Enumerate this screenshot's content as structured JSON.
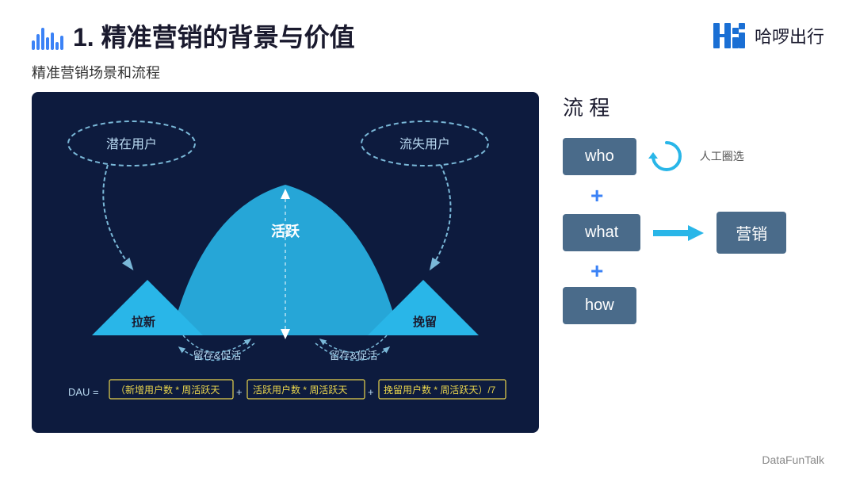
{
  "header": {
    "title": "1. 精准营销的背景与价值",
    "logo_text": "哈啰出行"
  },
  "subtitle": "精准营销场景和流程",
  "diagram": {
    "latent_users": "潜在用户",
    "lost_users": "流失用户",
    "active_label": "活跃",
    "acquire_label": "拉新",
    "retain_left": "留存&促活",
    "retain_right": "留存&促活",
    "churn_label": "挽留",
    "formula_prefix": "DAU =",
    "formula_part1": "（新增用户数 * 周活跃天",
    "formula_plus1": "+",
    "formula_part2": "活跃用户数 * 周活跃天",
    "formula_plus2": "+",
    "formula_part3": "挽留用户数 * 周活跃天）/7"
  },
  "flow": {
    "title": "流 程",
    "who_label": "who",
    "what_label": "what",
    "how_label": "how",
    "marketing_label": "营销",
    "manual_label": "人工圈选",
    "plus": "+",
    "arrow": "→"
  },
  "footer": {
    "brand": "DataFunTalk"
  }
}
